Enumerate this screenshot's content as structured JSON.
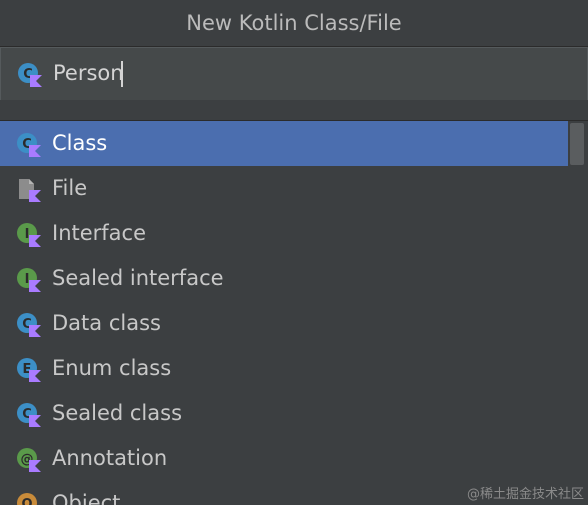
{
  "dialog": {
    "title": "New Kotlin Class/File"
  },
  "name_field": {
    "value": "Person",
    "icon": "kotlin-class-icon"
  },
  "kinds": [
    {
      "label": "Class",
      "icon": "kotlin-class-icon",
      "letter": "C",
      "color": "#3c8fc6",
      "selected": true
    },
    {
      "label": "File",
      "icon": "kotlin-file-icon",
      "letter": "",
      "color": "#8c8c8c",
      "selected": false
    },
    {
      "label": "Interface",
      "icon": "kotlin-interface-icon",
      "letter": "I",
      "color": "#5a9a4a",
      "selected": false
    },
    {
      "label": "Sealed interface",
      "icon": "kotlin-sealed-interface-icon",
      "letter": "I",
      "color": "#5a9a4a",
      "selected": false
    },
    {
      "label": "Data class",
      "icon": "kotlin-data-class-icon",
      "letter": "C",
      "color": "#3c8fc6",
      "selected": false
    },
    {
      "label": "Enum class",
      "icon": "kotlin-enum-class-icon",
      "letter": "E",
      "color": "#3c8fc6",
      "selected": false
    },
    {
      "label": "Sealed class",
      "icon": "kotlin-sealed-class-icon",
      "letter": "C",
      "color": "#3c8fc6",
      "selected": false
    },
    {
      "label": "Annotation",
      "icon": "kotlin-annotation-icon",
      "letter": "@",
      "color": "#5a9a4a",
      "selected": false
    },
    {
      "label": "Object",
      "icon": "kotlin-object-icon",
      "letter": "O",
      "color": "#c88b3a",
      "selected": false
    }
  ],
  "watermark": "@稀土掘金技术社区",
  "colors": {
    "selection": "#4b6eaf",
    "background": "#3c3f41",
    "kotlin_badge": "#a97bff"
  }
}
